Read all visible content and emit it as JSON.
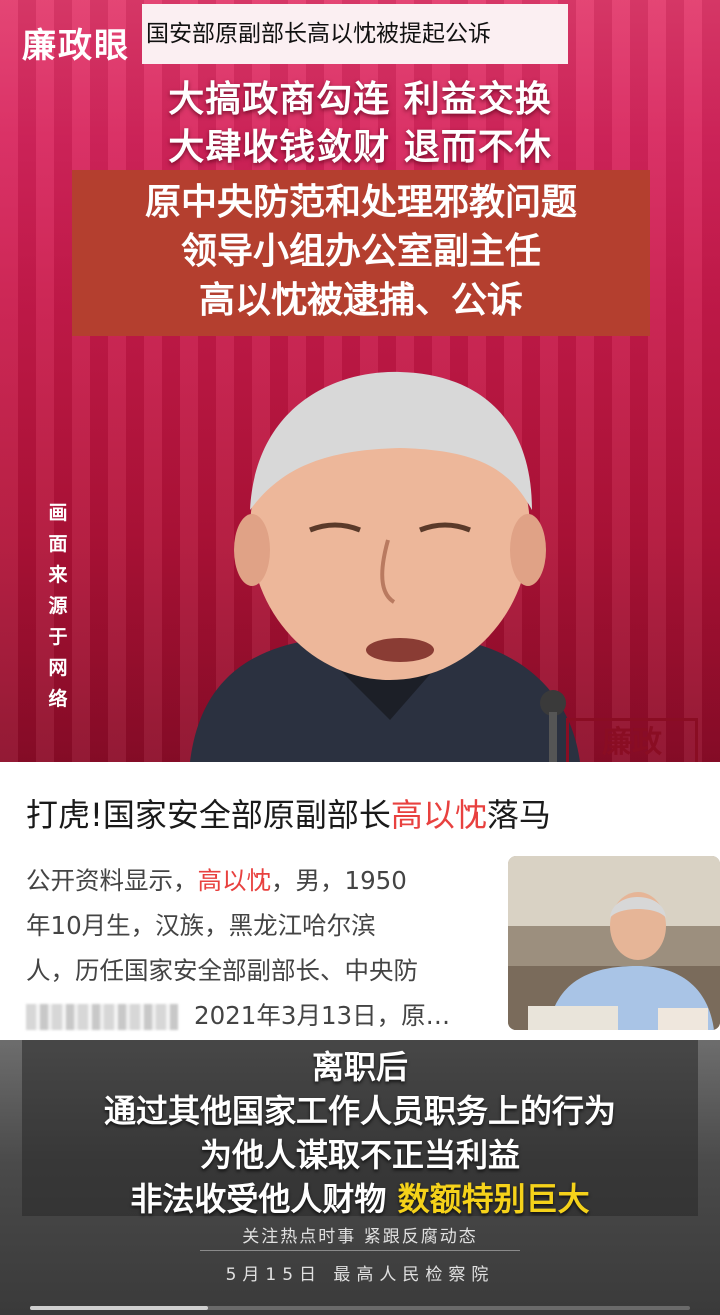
{
  "top_video": {
    "brand_logo": "廉政眼",
    "top_caption": "国安部原副部长高以忱被提起公诉",
    "headline_line1": "大搞政商勾连 利益交换",
    "headline_line2": "大肆收钱敛财 退而不休",
    "title_box_lines": [
      "原中央防范和处理邪教问题",
      "领导小组办公室副主任",
      "高以忱被逮捕、公诉"
    ],
    "vertical_note": "画面来源于网络",
    "stamp_text": "廉政"
  },
  "article": {
    "title_prefix": "打虎!国家安全部原副部长",
    "title_highlight": "高以忱",
    "title_suffix": "落马",
    "summary_line1_prefix": "公开资料显示，",
    "summary_line1_highlight": "高以忱",
    "summary_line1_suffix": "，男，1950",
    "summary_line2": "年10月生，汉族，黑龙江哈尔滨",
    "summary_line3": "人，历任国家安全部副部长、中央防",
    "summary_line4": "2021年3月13日，原…"
  },
  "bottom_video": {
    "subtitle_line1": "离职后",
    "subtitle_line2": "通过其他国家工作人员职务上的行为",
    "subtitle_line3": "为他人谋取不正当利益",
    "subtitle_line4_prefix": "非法收受他人财物 ",
    "subtitle_line4_highlight": "数额特别巨大",
    "tagline": "关注热点时事  紧跟反腐动态",
    "dateline": "5月15日  最高人民检察院",
    "progress_fraction": 0.27
  },
  "colors": {
    "highlight_red": "#e8413f",
    "subtitle_yellow": "#f5d21a",
    "title_box_bg": "#b43f2f"
  }
}
